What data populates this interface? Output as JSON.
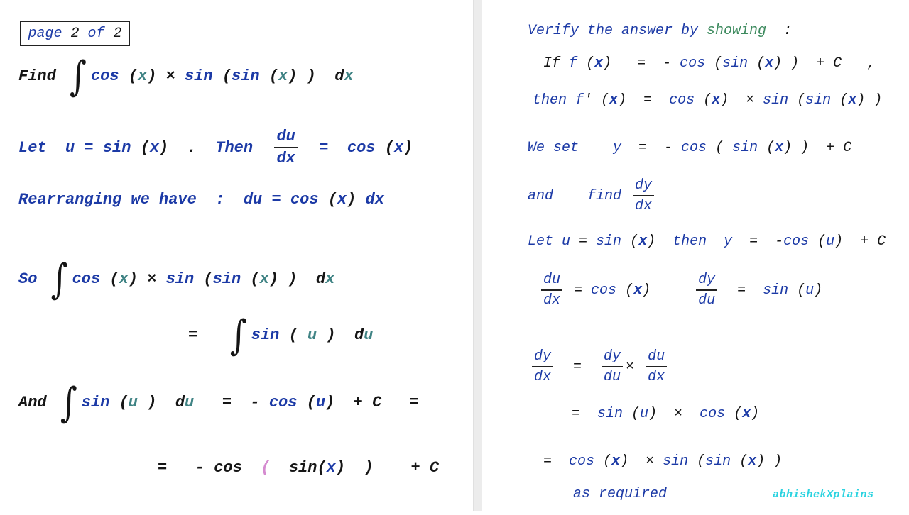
{
  "page_label": {
    "page": "page",
    "num": "2",
    "of": "of",
    "total": "2"
  },
  "left": [
    [
      [
        "Find ",
        "K"
      ],
      [
        "∫",
        "int"
      ],
      [
        "cos",
        "B"
      ],
      [
        " (",
        "k"
      ],
      [
        "x",
        "T"
      ],
      [
        ") ",
        "k"
      ],
      [
        "× ",
        "K"
      ],
      [
        "sin",
        "B"
      ],
      [
        " (",
        "k"
      ],
      [
        "sin",
        "B"
      ],
      [
        " (",
        "k"
      ],
      [
        "x",
        "T"
      ],
      [
        ") )  ",
        "k"
      ],
      [
        "d",
        "K"
      ],
      [
        "x",
        "T"
      ]
    ],
    [
      [
        "Let  u = sin ",
        "B"
      ],
      [
        "(",
        "k"
      ],
      [
        "x",
        "B"
      ],
      [
        ")  .  ",
        "k"
      ],
      [
        "Then  ",
        "B"
      ],
      [
        "du/dx",
        "frac"
      ],
      [
        "  =  cos ",
        "B"
      ],
      [
        "(",
        "k"
      ],
      [
        "x",
        "B"
      ],
      [
        ")",
        "k"
      ]
    ],
    [
      [
        "Rearranging we have  :  ",
        "B"
      ],
      [
        "du = cos ",
        "b"
      ],
      [
        "(",
        "k"
      ],
      [
        "x",
        "B"
      ],
      [
        ") ",
        "k"
      ],
      [
        "dx",
        "b"
      ]
    ],
    [
      [
        "So ",
        "b"
      ],
      [
        "∫",
        "int"
      ],
      [
        "cos",
        "B"
      ],
      [
        " (",
        "k"
      ],
      [
        "x",
        "T"
      ],
      [
        ") ",
        "k"
      ],
      [
        "× ",
        "K"
      ],
      [
        "sin",
        "B"
      ],
      [
        " (",
        "k"
      ],
      [
        "sin",
        "B"
      ],
      [
        " (",
        "k"
      ],
      [
        "x",
        "T"
      ],
      [
        ") )  ",
        "k"
      ],
      [
        "d",
        "K"
      ],
      [
        "x",
        "T"
      ]
    ],
    [
      [
        "=   ",
        "K"
      ],
      [
        "∫",
        "int"
      ],
      [
        "sin",
        "B"
      ],
      [
        " ( ",
        "k"
      ],
      [
        "u",
        "T"
      ],
      [
        " )  ",
        "k"
      ],
      [
        "d",
        "K"
      ],
      [
        "u",
        "T"
      ]
    ],
    [
      [
        "And ",
        "K"
      ],
      [
        "∫",
        "int"
      ],
      [
        "sin",
        "B"
      ],
      [
        " (",
        "k"
      ],
      [
        "u",
        "T"
      ],
      [
        " )  ",
        "k"
      ],
      [
        "d",
        "K"
      ],
      [
        "u",
        "T"
      ],
      [
        "   =  - ",
        "K"
      ],
      [
        "cos",
        "B"
      ],
      [
        " (",
        "k"
      ],
      [
        "u",
        "B"
      ],
      [
        ")  + C   =",
        "K"
      ]
    ],
    [
      [
        "=   - cos  ",
        "k"
      ],
      [
        "(",
        "p"
      ],
      [
        "  sin(",
        "k"
      ],
      [
        "x",
        "B"
      ],
      [
        ")  )    + C",
        "k"
      ]
    ]
  ],
  "right": [
    [
      [
        "Verify the answer by ",
        "b"
      ],
      [
        "showing",
        "g"
      ],
      [
        "  :",
        "k"
      ]
    ],
    [
      [
        "If ",
        "k"
      ],
      [
        "f",
        "b"
      ],
      [
        " (",
        "k"
      ],
      [
        "x",
        "B"
      ],
      [
        ")   =  - ",
        "k"
      ],
      [
        "cos",
        "b"
      ],
      [
        " (",
        "k"
      ],
      [
        "sin",
        "b"
      ],
      [
        " (",
        "k"
      ],
      [
        "x",
        "B"
      ],
      [
        ") )  + C   ,",
        "k"
      ]
    ],
    [
      [
        "then f",
        "b"
      ],
      [
        "'",
        "k"
      ],
      [
        " (",
        "k"
      ],
      [
        "x",
        "B"
      ],
      [
        ")  =  ",
        "k"
      ],
      [
        "cos",
        "b"
      ],
      [
        " (",
        "k"
      ],
      [
        "x",
        "B"
      ],
      [
        ")  × ",
        "k"
      ],
      [
        "sin",
        "b"
      ],
      [
        " (",
        "k"
      ],
      [
        "sin",
        "b"
      ],
      [
        " (",
        "k"
      ],
      [
        "x",
        "B"
      ],
      [
        ") )",
        "k"
      ]
    ],
    [
      [
        "We set    y",
        "b"
      ],
      [
        "  =  - ",
        "k"
      ],
      [
        "cos",
        "b"
      ],
      [
        " ( ",
        "k"
      ],
      [
        "sin",
        "b"
      ],
      [
        " (",
        "k"
      ],
      [
        "x",
        "B"
      ],
      [
        ") )  + C",
        "k"
      ]
    ],
    [
      [
        "and    find ",
        "b"
      ],
      [
        "dy/dx",
        "frac"
      ]
    ],
    [
      [
        "Let u ",
        "b"
      ],
      [
        "= ",
        "k"
      ],
      [
        "sin",
        "b"
      ],
      [
        " (",
        "k"
      ],
      [
        "x",
        "B"
      ],
      [
        ")  ",
        "k"
      ],
      [
        "then  y",
        "b"
      ],
      [
        "  =  -",
        "k"
      ],
      [
        "cos",
        "b"
      ],
      [
        " (",
        "k"
      ],
      [
        "u",
        "b"
      ],
      [
        ")  + C",
        "k"
      ]
    ],
    [
      [
        "du/dx",
        "frac"
      ],
      [
        " = ",
        "k"
      ],
      [
        "cos",
        "b"
      ],
      [
        " (",
        "k"
      ],
      [
        "x",
        "B"
      ],
      [
        ")     ",
        "k"
      ],
      [
        "dy/du",
        "frac"
      ],
      [
        "  =  ",
        "k"
      ],
      [
        "sin",
        "b"
      ],
      [
        " (",
        "k"
      ],
      [
        "u",
        "b"
      ],
      [
        ")",
        "k"
      ]
    ],
    [
      [
        "dy/dx",
        "frac"
      ],
      [
        "  =  ",
        "k"
      ],
      [
        "dy/du",
        "frac"
      ],
      [
        "× ",
        "k"
      ],
      [
        "du/dx",
        "frac"
      ]
    ],
    [
      [
        "=  ",
        "k"
      ],
      [
        "sin",
        "b"
      ],
      [
        " (",
        "k"
      ],
      [
        "u",
        "b"
      ],
      [
        ")  ×  ",
        "k"
      ],
      [
        "cos",
        "b"
      ],
      [
        " (",
        "k"
      ],
      [
        "x",
        "B"
      ],
      [
        ")",
        "k"
      ]
    ],
    [
      [
        "=  ",
        "k"
      ],
      [
        "cos",
        "b"
      ],
      [
        " (",
        "k"
      ],
      [
        "x",
        "B"
      ],
      [
        ")  × ",
        "k"
      ],
      [
        "sin",
        "b"
      ],
      [
        " (",
        "k"
      ],
      [
        "sin",
        "b"
      ],
      [
        " (",
        "k"
      ],
      [
        "x",
        "B"
      ],
      [
        ") )",
        "k"
      ]
    ],
    [
      [
        "as required",
        "b"
      ]
    ]
  ],
  "watermark": "abhishekXplains",
  "colors": {
    "blue": "#1c3aa6",
    "teal": "#3f8384",
    "green": "#3d8a5e",
    "pink": "#d58bd0",
    "watermark": "#2cd3e0",
    "divider": "#ececec"
  }
}
